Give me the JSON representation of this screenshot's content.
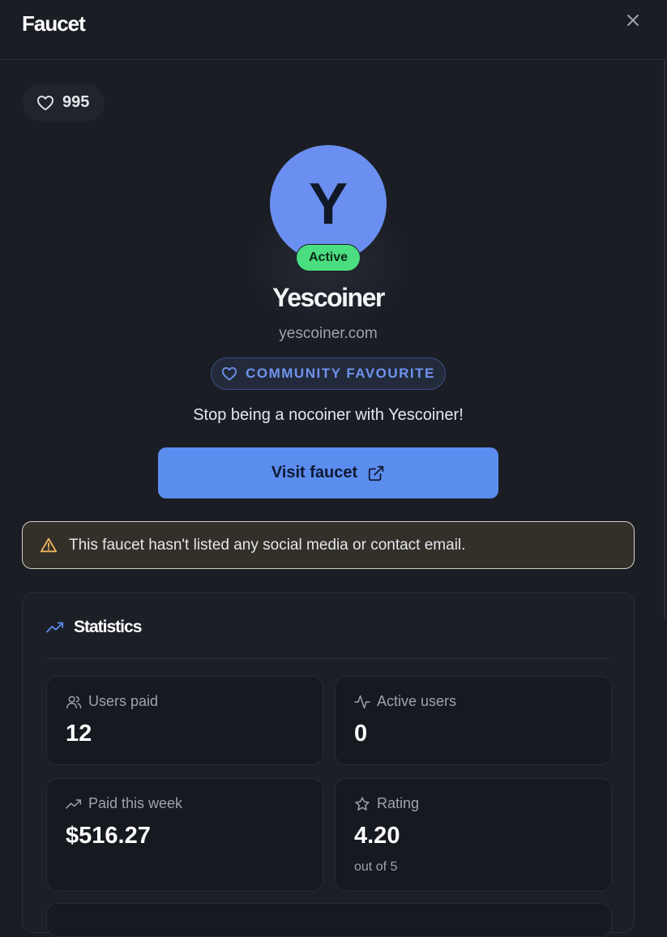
{
  "header": {
    "title": "Faucet",
    "close_icon": "close-icon"
  },
  "likes": {
    "count": "995",
    "icon": "heart-icon"
  },
  "faucet": {
    "avatar_letter": "Y",
    "status": "Active",
    "name": "Yescoiner",
    "domain": "yescoiner.com",
    "badge": "COMMUNITY FAVOURITE",
    "tagline": "Stop being a nocoiner with Yescoiner!"
  },
  "actions": {
    "visit_label": "Visit faucet",
    "visit_icon": "external-link-icon"
  },
  "warning": {
    "icon": "warning-triangle-icon",
    "text": "This faucet hasn't listed any social media or contact email."
  },
  "statistics": {
    "title": "Statistics",
    "icon": "trending-up-icon",
    "users_paid": {
      "label": "Users paid",
      "value": "12",
      "icon": "users-icon"
    },
    "active_users": {
      "label": "Active users",
      "value": "0",
      "icon": "activity-icon"
    },
    "paid_this_week": {
      "label": "Paid this week",
      "value": "$516.27",
      "icon": "trending-up-icon"
    },
    "rating": {
      "label": "Rating",
      "value": "4.20",
      "sub": "out of 5",
      "icon": "star-icon"
    }
  },
  "colors": {
    "background": "#1a1d24",
    "accent": "#5b8def",
    "active": "#4ade80",
    "warning": "#f0b35a"
  }
}
